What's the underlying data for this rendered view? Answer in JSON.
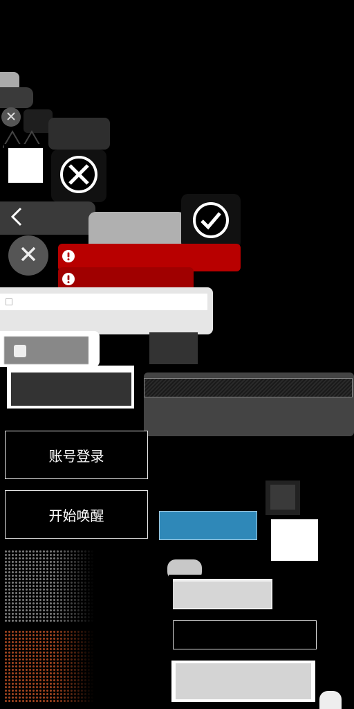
{
  "buttons": {
    "account_login": "账号登录",
    "start_wake": "开始唤醒"
  },
  "icons": {
    "small_close": "close-icon",
    "circle_close": "circle-close-icon",
    "back": "chevron-left-icon",
    "check": "check-circle-icon",
    "gray_close": "close-icon",
    "alert": "exclamation-icon"
  },
  "colors": {
    "alert_red": "#b80000",
    "alert_red_dark": "#a00000",
    "blue_bar": "#2f88b8",
    "orange_dots": "#a0441f"
  }
}
